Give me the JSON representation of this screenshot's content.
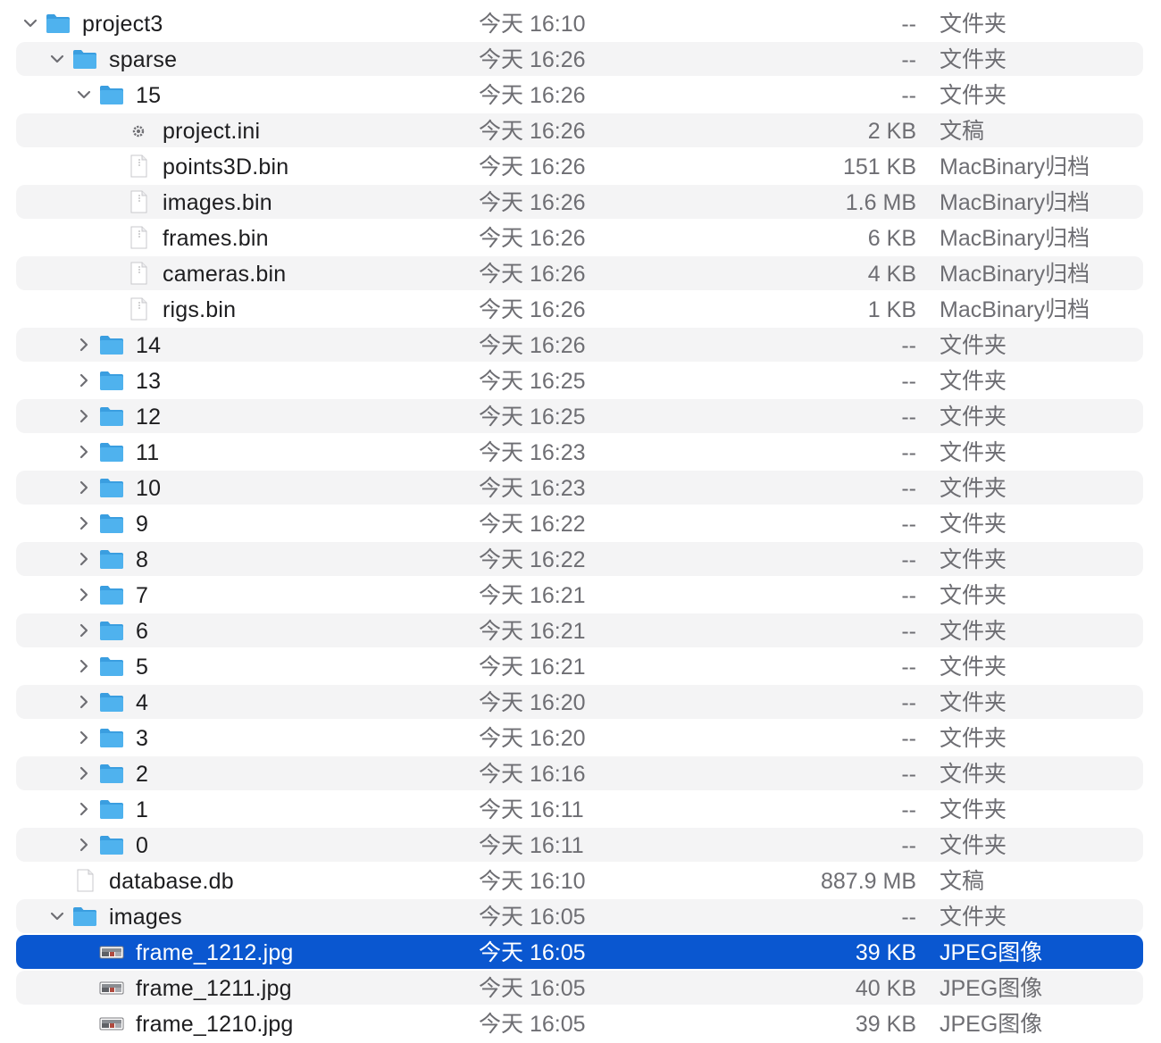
{
  "colors": {
    "folder": "#4fb2ee",
    "selection": "#0a57d0",
    "stripe": "#f4f4f5",
    "secondary_text": "#6e6e73"
  },
  "rows": [
    {
      "name": "project3",
      "date": "今天 16:10",
      "size": "--",
      "kind": "文件夹",
      "level": 0,
      "icon": "folder-icon",
      "disclosure": "expanded"
    },
    {
      "name": "sparse",
      "date": "今天 16:26",
      "size": "--",
      "kind": "文件夹",
      "level": 1,
      "icon": "folder-icon",
      "disclosure": "expanded"
    },
    {
      "name": "15",
      "date": "今天 16:26",
      "size": "--",
      "kind": "文件夹",
      "level": 2,
      "icon": "folder-icon",
      "disclosure": "expanded"
    },
    {
      "name": "project.ini",
      "date": "今天 16:26",
      "size": "2 KB",
      "kind": "文稿",
      "level": 3,
      "icon": "settings-file-icon",
      "disclosure": "none"
    },
    {
      "name": "points3D.bin",
      "date": "今天 16:26",
      "size": "151 KB",
      "kind": "MacBinary归档",
      "level": 3,
      "icon": "archive-file-icon",
      "disclosure": "none"
    },
    {
      "name": "images.bin",
      "date": "今天 16:26",
      "size": "1.6 MB",
      "kind": "MacBinary归档",
      "level": 3,
      "icon": "archive-file-icon",
      "disclosure": "none"
    },
    {
      "name": "frames.bin",
      "date": "今天 16:26",
      "size": "6 KB",
      "kind": "MacBinary归档",
      "level": 3,
      "icon": "archive-file-icon",
      "disclosure": "none"
    },
    {
      "name": "cameras.bin",
      "date": "今天 16:26",
      "size": "4 KB",
      "kind": "MacBinary归档",
      "level": 3,
      "icon": "archive-file-icon",
      "disclosure": "none"
    },
    {
      "name": "rigs.bin",
      "date": "今天 16:26",
      "size": "1 KB",
      "kind": "MacBinary归档",
      "level": 3,
      "icon": "archive-file-icon",
      "disclosure": "none"
    },
    {
      "name": "14",
      "date": "今天 16:26",
      "size": "--",
      "kind": "文件夹",
      "level": 2,
      "icon": "folder-icon",
      "disclosure": "collapsed"
    },
    {
      "name": "13",
      "date": "今天 16:25",
      "size": "--",
      "kind": "文件夹",
      "level": 2,
      "icon": "folder-icon",
      "disclosure": "collapsed"
    },
    {
      "name": "12",
      "date": "今天 16:25",
      "size": "--",
      "kind": "文件夹",
      "level": 2,
      "icon": "folder-icon",
      "disclosure": "collapsed"
    },
    {
      "name": "11",
      "date": "今天 16:23",
      "size": "--",
      "kind": "文件夹",
      "level": 2,
      "icon": "folder-icon",
      "disclosure": "collapsed"
    },
    {
      "name": "10",
      "date": "今天 16:23",
      "size": "--",
      "kind": "文件夹",
      "level": 2,
      "icon": "folder-icon",
      "disclosure": "collapsed"
    },
    {
      "name": "9",
      "date": "今天 16:22",
      "size": "--",
      "kind": "文件夹",
      "level": 2,
      "icon": "folder-icon",
      "disclosure": "collapsed"
    },
    {
      "name": "8",
      "date": "今天 16:22",
      "size": "--",
      "kind": "文件夹",
      "level": 2,
      "icon": "folder-icon",
      "disclosure": "collapsed"
    },
    {
      "name": "7",
      "date": "今天 16:21",
      "size": "--",
      "kind": "文件夹",
      "level": 2,
      "icon": "folder-icon",
      "disclosure": "collapsed"
    },
    {
      "name": "6",
      "date": "今天 16:21",
      "size": "--",
      "kind": "文件夹",
      "level": 2,
      "icon": "folder-icon",
      "disclosure": "collapsed"
    },
    {
      "name": "5",
      "date": "今天 16:21",
      "size": "--",
      "kind": "文件夹",
      "level": 2,
      "icon": "folder-icon",
      "disclosure": "collapsed"
    },
    {
      "name": "4",
      "date": "今天 16:20",
      "size": "--",
      "kind": "文件夹",
      "level": 2,
      "icon": "folder-icon",
      "disclosure": "collapsed"
    },
    {
      "name": "3",
      "date": "今天 16:20",
      "size": "--",
      "kind": "文件夹",
      "level": 2,
      "icon": "folder-icon",
      "disclosure": "collapsed"
    },
    {
      "name": "2",
      "date": "今天 16:16",
      "size": "--",
      "kind": "文件夹",
      "level": 2,
      "icon": "folder-icon",
      "disclosure": "collapsed"
    },
    {
      "name": "1",
      "date": "今天 16:11",
      "size": "--",
      "kind": "文件夹",
      "level": 2,
      "icon": "folder-icon",
      "disclosure": "collapsed"
    },
    {
      "name": "0",
      "date": "今天 16:11",
      "size": "--",
      "kind": "文件夹",
      "level": 2,
      "icon": "folder-icon",
      "disclosure": "collapsed"
    },
    {
      "name": "database.db",
      "date": "今天 16:10",
      "size": "887.9 MB",
      "kind": "文稿",
      "level": 1,
      "icon": "document-file-icon",
      "disclosure": "none"
    },
    {
      "name": "images",
      "date": "今天 16:05",
      "size": "--",
      "kind": "文件夹",
      "level": 1,
      "icon": "folder-icon",
      "disclosure": "expanded"
    },
    {
      "name": "frame_1212.jpg",
      "date": "今天 16:05",
      "size": "39 KB",
      "kind": "JPEG图像",
      "level": 2,
      "icon": "image-thumbnail-icon",
      "disclosure": "none",
      "selected": true
    },
    {
      "name": "frame_1211.jpg",
      "date": "今天 16:05",
      "size": "40 KB",
      "kind": "JPEG图像",
      "level": 2,
      "icon": "image-thumbnail-icon",
      "disclosure": "none"
    },
    {
      "name": "frame_1210.jpg",
      "date": "今天 16:05",
      "size": "39 KB",
      "kind": "JPEG图像",
      "level": 2,
      "icon": "image-thumbnail-icon",
      "disclosure": "none"
    }
  ]
}
